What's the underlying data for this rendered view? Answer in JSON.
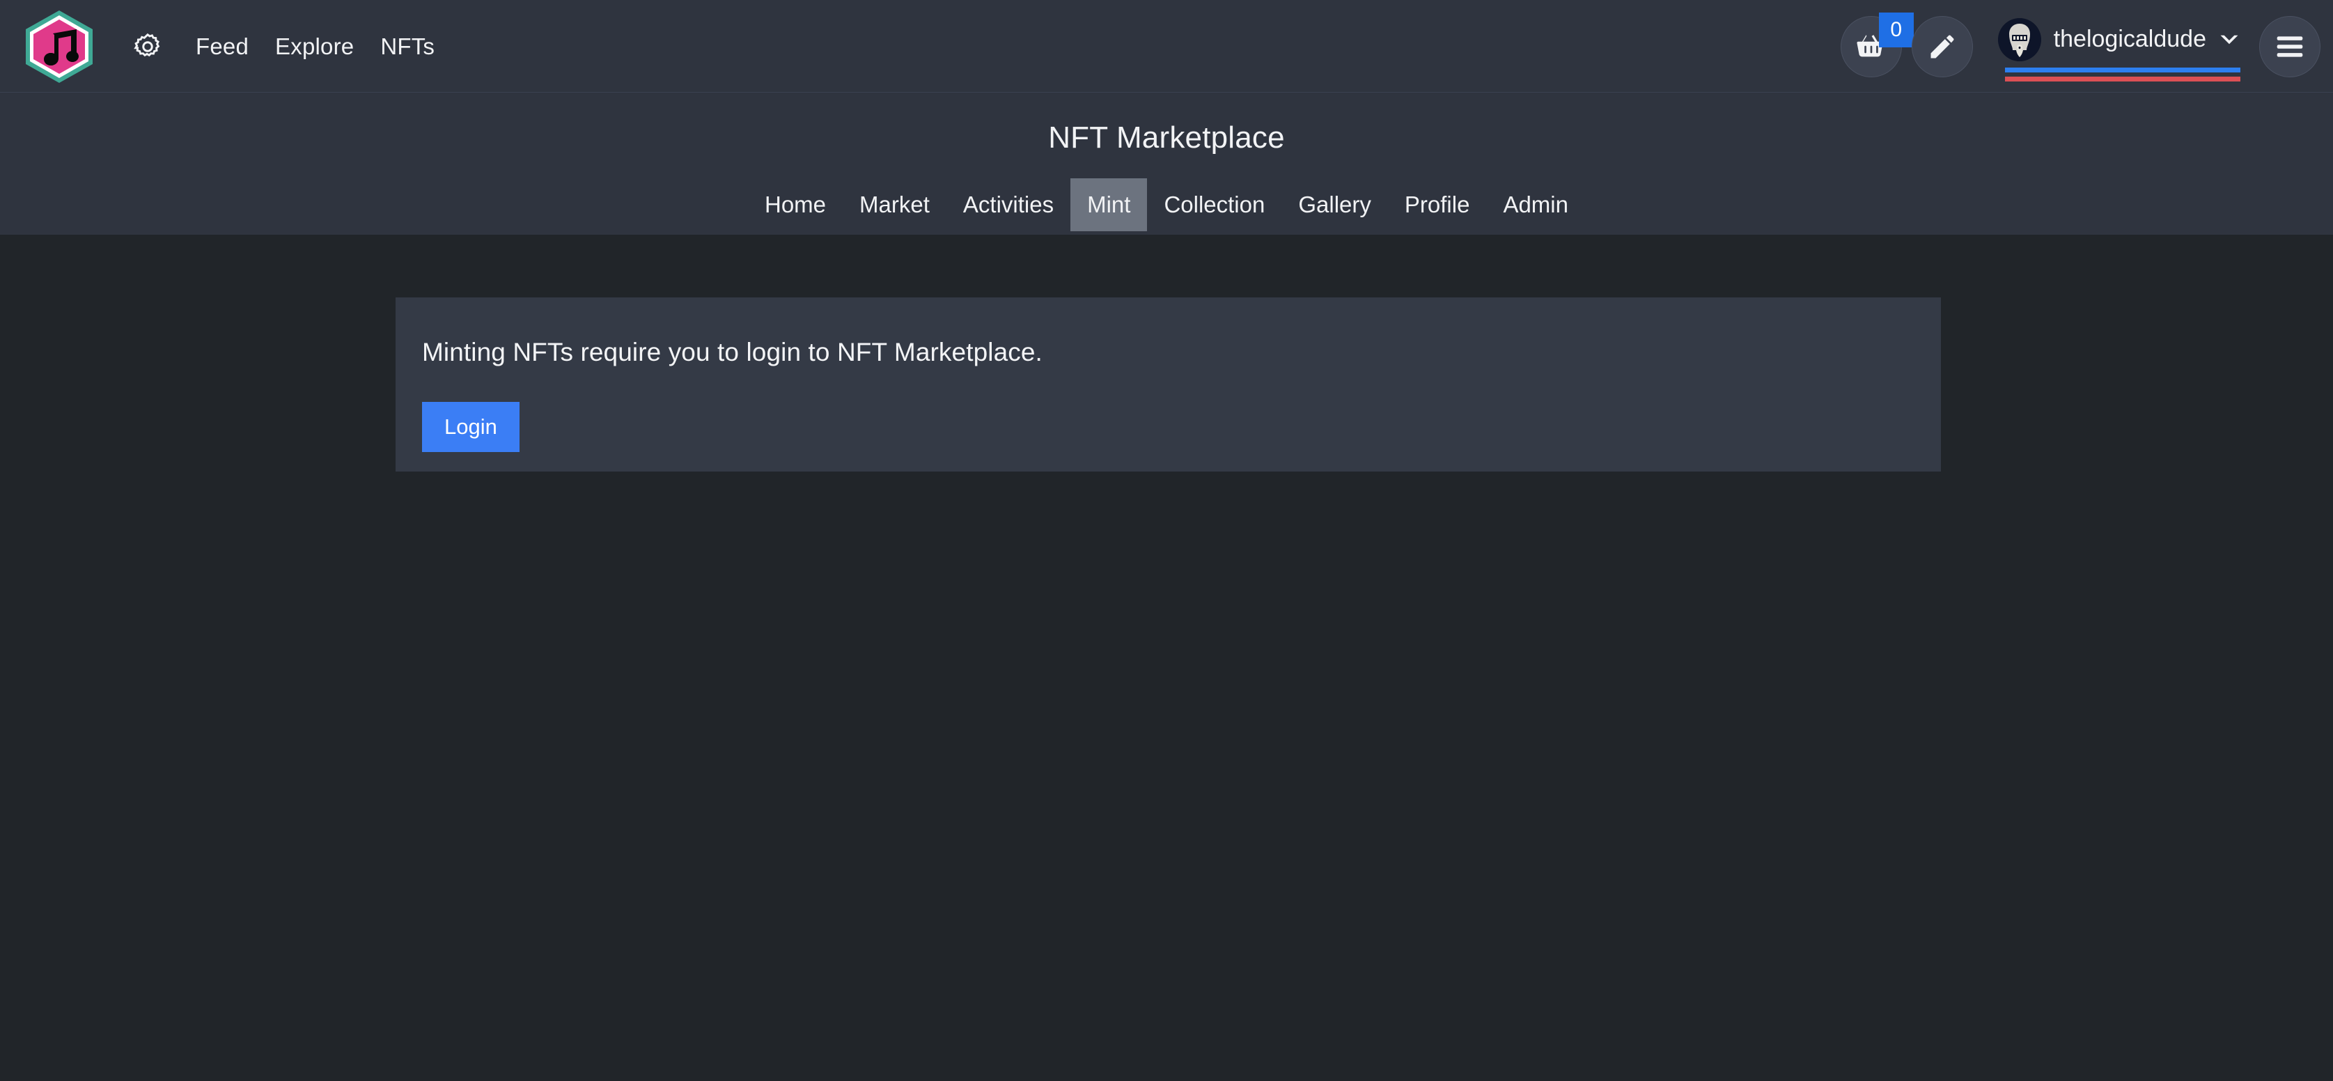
{
  "topbar": {
    "logo_icon": "music-note-hexagon-logo",
    "gear_icon": "gear-icon",
    "links": [
      {
        "label": "Feed"
      },
      {
        "label": "Explore"
      },
      {
        "label": "NFTs"
      }
    ],
    "cart": {
      "icon": "shopping-basket-icon",
      "badge_count": "0",
      "badge_color": "#1f6fe5"
    },
    "compose": {
      "icon": "pencil-icon"
    },
    "user": {
      "avatar_icon": "user-avatar",
      "name": "thelogicaldude",
      "chevron_icon": "chevron-down-icon",
      "underline_blue": "#2d7ff0",
      "underline_red": "#dc5055"
    },
    "menu": {
      "icon": "hamburger-menu-icon"
    }
  },
  "subheader": {
    "title": "NFT Marketplace",
    "tabs": [
      {
        "label": "Home",
        "active": false
      },
      {
        "label": "Market",
        "active": false
      },
      {
        "label": "Activities",
        "active": false
      },
      {
        "label": "Mint",
        "active": true
      },
      {
        "label": "Collection",
        "active": false
      },
      {
        "label": "Gallery",
        "active": false
      },
      {
        "label": "Profile",
        "active": false
      },
      {
        "label": "Admin",
        "active": false
      }
    ],
    "active_tab_color": "#6c737f"
  },
  "main": {
    "card": {
      "message": "Minting NFTs require you to login to NFT Marketplace.",
      "login_label": "Login",
      "login_color": "#3b7ef5",
      "background": "#343a46"
    }
  },
  "theme": {
    "page_background": "#212529",
    "header_background": "#2f343f",
    "text_color": "#f2f3f5"
  }
}
